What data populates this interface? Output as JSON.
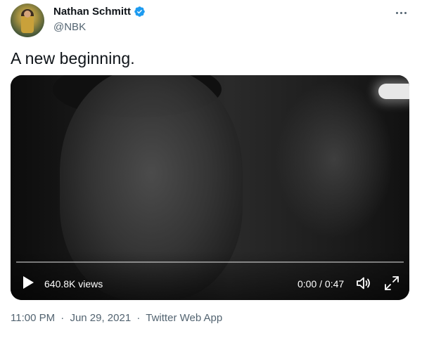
{
  "author": {
    "display_name": "Nathan Schmitt",
    "handle": "@NBK",
    "verified": true,
    "verified_color": "#1d9bf0"
  },
  "more_button": {
    "icon": "more-horizontal-icon"
  },
  "tweet": {
    "text": "A new beginning."
  },
  "video": {
    "views": "640.8K views",
    "time_display": "0:00 / 0:47",
    "progress_fraction": 0.0,
    "play_icon": "play-icon",
    "volume_icon": "volume-icon",
    "fullscreen_icon": "fullscreen-icon"
  },
  "meta": {
    "time": "11:00 PM",
    "separator": "·",
    "date": "Jun 29, 2021",
    "source": "Twitter Web App"
  },
  "colors": {
    "text_primary": "#0f1419",
    "text_secondary": "#536471",
    "brand_blue": "#1d9bf0"
  }
}
